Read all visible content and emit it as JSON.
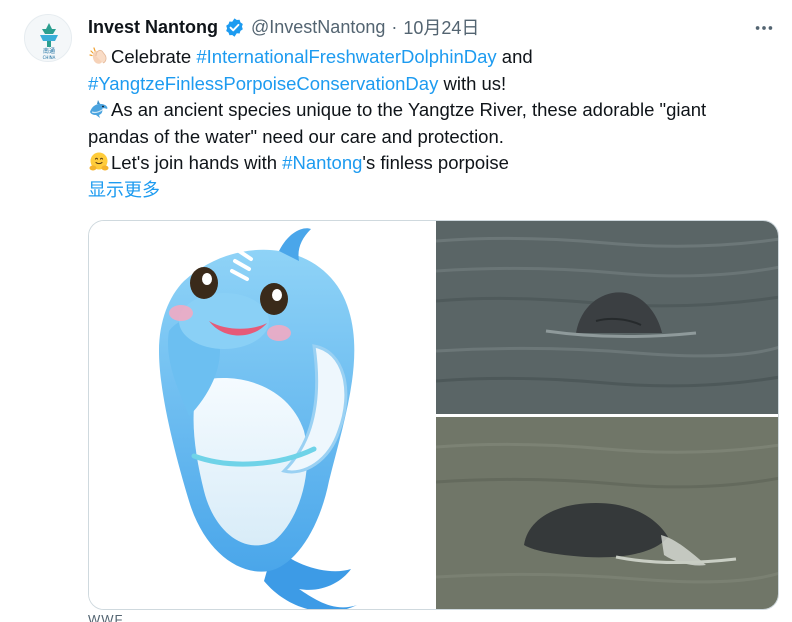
{
  "account": {
    "name": "Invest Nantong",
    "handle": "@InvestNantong",
    "separator": "·",
    "date": "10月24日",
    "avatar_text": "南通",
    "avatar_subtext": "CHINA"
  },
  "post": {
    "l1_pre": "Celebrate ",
    "l1_tag": "#InternationalFreshwaterDolphinDay",
    "l1_post": " and",
    "l2_tag": "#YangtzeFinlessPorpoiseConservationDay",
    "l2_post": " with us!",
    "l3": "As an ancient species unique to the Yangtze River, these adorable \"giant",
    "l4": "pandas of the water\" need our care and protection.",
    "l5_pre": "Let's join hands with ",
    "l5_tag": "#Nantong",
    "l5_post": "'s finless porpoise",
    "show_more": "显示更多"
  },
  "icons": {
    "verified": "verified-badge-icon",
    "more": "more-options-icon",
    "clap": "clapping-hands-emoji",
    "dolphin": "dolphin-emoji",
    "hug": "hugging-face-emoji"
  },
  "footer_partial": "WWF",
  "colors": {
    "link": "#1d9bf0",
    "text": "#0f1419",
    "muted": "#536471",
    "border": "#cfd9de"
  }
}
